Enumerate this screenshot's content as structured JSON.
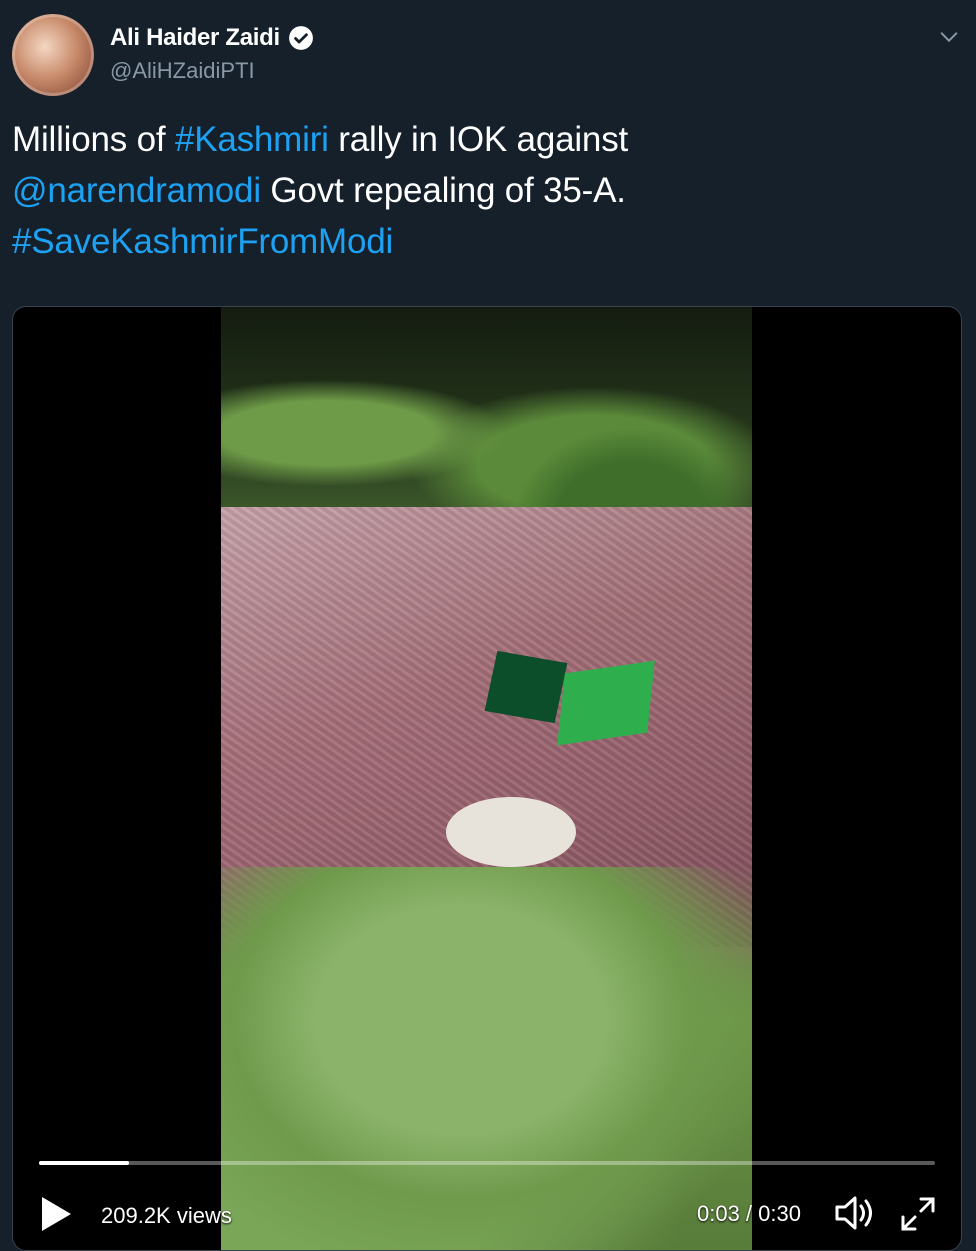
{
  "author": {
    "name": "Ali Haider Zaidi",
    "handle": "@AliHZaidiPTI",
    "verified": true,
    "avatar_icon": "avatar-photo"
  },
  "tweet": {
    "segments": [
      {
        "text": "Millions of ",
        "type": "text"
      },
      {
        "text": "#Kashmiri",
        "type": "link"
      },
      {
        "text": " rally in IOK against ",
        "type": "text"
      },
      {
        "text": "@narendramodi",
        "type": "link"
      },
      {
        "text": " Govt repealing of 35-A. ",
        "type": "text"
      },
      {
        "text": "#SaveKashmirFromModi",
        "type": "link"
      }
    ]
  },
  "video": {
    "views": "209.2K views",
    "time": "0:03 / 0:30",
    "progress": 0.1
  },
  "colors": {
    "background": "#15202b",
    "link": "#1da1f2",
    "muted": "#8899a6",
    "border": "#38444d"
  },
  "icons": {
    "verified": "verified-badge-icon",
    "caret": "chevron-down-icon",
    "play": "play-icon",
    "volume": "volume-icon",
    "fullscreen": "fullscreen-icon"
  }
}
